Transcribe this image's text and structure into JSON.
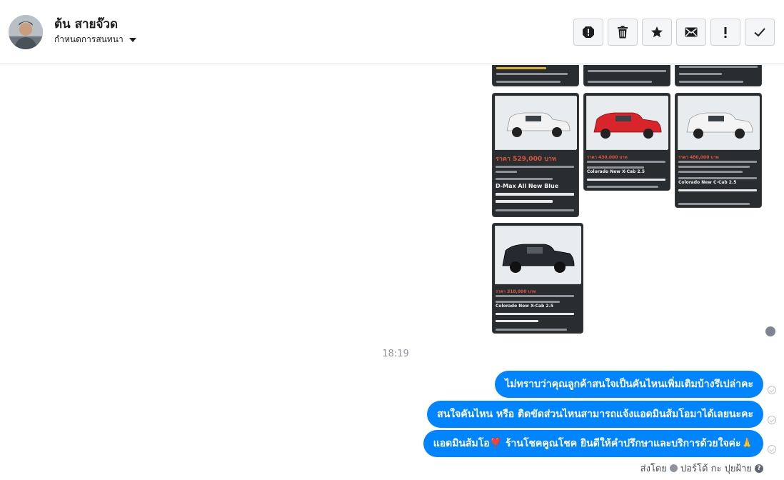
{
  "header": {
    "contact_name": "ต้น สายจ๊วด",
    "assign_label": "กำหนดการสนทนา",
    "actions": [
      "report-icon",
      "trash-icon",
      "star-icon",
      "envelope-icon",
      "exclamation-icon",
      "check-icon"
    ]
  },
  "thread": {
    "time_separator": "18:19",
    "messages": [
      "ไม่ทราบว่าคุณลูกค้าสนใจเป็นคันไหนเพิ่มเติมบ้างรึเปล่าคะ",
      "สนใจคันไหน หรือ ติดขัดส่วนไหนสามารถแจ้งแอดมินส้มโอมาได้เลยนะคะ",
      "แอดมินส้มโอ❣️ ร้านโชคคูณโชค ยินดีให้คำปรึกษาและบริการด้วยใจค่ะ🙏"
    ],
    "sent_by_prefix": "ส่งโดย",
    "sent_by_name": "ปอร์โต้ กะ ปุยฝ้าย",
    "help_glyph": "?"
  },
  "cards": [
    {
      "price": "ราคา 529,000 บาท",
      "model": "D-Max All New Blue",
      "car_color": "#f2f2f2"
    },
    {
      "price": "ราคา 430,000 บาท",
      "model": "Colorado New X-Cab 2.5",
      "car_color": "#d8242a"
    },
    {
      "price": "ราคา 480,000 บาท",
      "model": "Colorado New C-Cab 2.5",
      "car_color": "#f4f4f4"
    },
    {
      "price": "ราคา 318,000 บาท",
      "model": "Colorado New X-Cab 2.5",
      "car_color": "#262a30"
    }
  ],
  "colors": {
    "accent": "#0084ff",
    "header_border": "#dadde1"
  }
}
